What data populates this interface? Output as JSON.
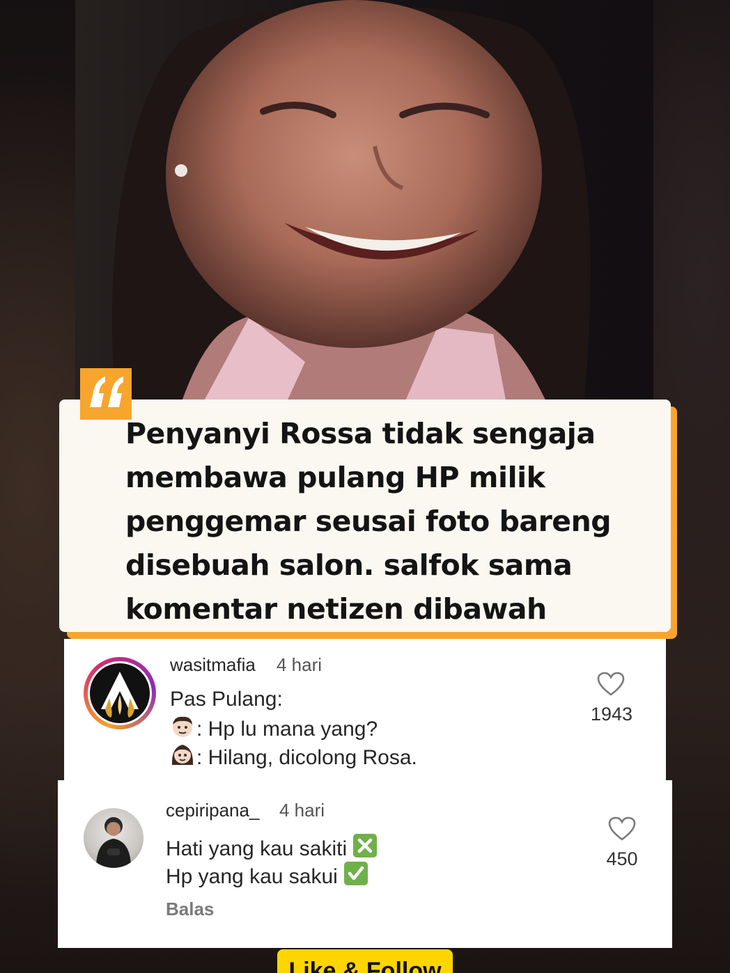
{
  "caption": {
    "text": "Penyanyi Rossa tidak sengaja membawa pulang HP milik penggemar seusai foto bareng disebuah salon. salfok sama komentar netizen dibawah"
  },
  "comments": [
    {
      "username": "wasitmafia",
      "time": "4 hari",
      "lines": [
        "Pas Pulang:",
        ": Hp lu mana yang?",
        ": Hilang, dicolong Rosa."
      ],
      "likes": "1943"
    },
    {
      "username": "cepiripana_",
      "time": "4 hari",
      "lines": [
        "Hati yang kau sakiti",
        "Hp yang kau sakui"
      ],
      "likes": "450",
      "reply_label": "Balas"
    }
  ],
  "follow_button": {
    "label": "Like & Follow"
  },
  "icons": {
    "quote": "quote-icon",
    "like": "heart-icon",
    "cross": "cross-mark-icon",
    "check": "check-mark-icon",
    "man": "man-emoji-icon",
    "woman": "woman-emoji-icon"
  },
  "colors": {
    "accent": "#f7a52c",
    "button": "#ffd500",
    "card": "#fbf8f1"
  }
}
